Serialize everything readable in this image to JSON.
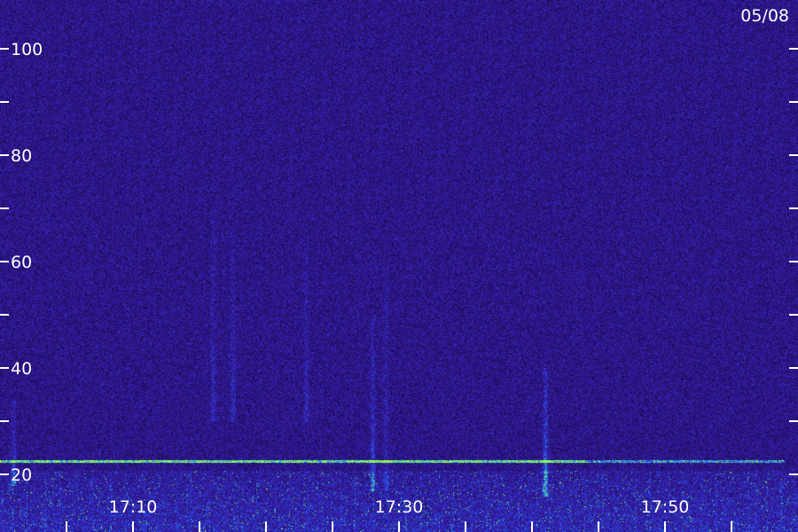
{
  "date_label": "05/08",
  "chart_data": {
    "type": "heatmap",
    "title": "",
    "xlabel": "",
    "ylabel": "",
    "ylim": [
      16,
      110
    ],
    "y_ticks_labeled": [
      20,
      40,
      60,
      80,
      100
    ],
    "y_ticks_minor": [
      30,
      50,
      70,
      90
    ],
    "x_time_range": [
      "17:00",
      "18:00"
    ],
    "x_ticks_labeled": [
      "17:10",
      "17:30",
      "17:50"
    ],
    "x_ticks_minor": [
      "17:05",
      "17:15",
      "17:20",
      "17:25",
      "17:35",
      "17:40",
      "17:45",
      "17:55"
    ],
    "colors": {
      "background": "#2a0f70",
      "noise_low": "#1a0a50",
      "noise_high": "#3a1fb0",
      "signal_mid": "#2060ff",
      "signal_high": "#30e0c0",
      "signal_peak": "#a0ff40"
    },
    "features": [
      {
        "kind": "horizontal_line",
        "freq": 22.5,
        "time_start": "17:00",
        "time_end": "17:44",
        "intensity": "high"
      },
      {
        "kind": "horizontal_line",
        "freq": 22.5,
        "time_start": "17:44",
        "time_end": "17:59",
        "intensity": "medium"
      },
      {
        "kind": "vertical_streak",
        "time": "17:16",
        "freq_low": 30,
        "freq_high": 70,
        "intensity": "low"
      },
      {
        "kind": "vertical_streak",
        "time": "17:17.5",
        "freq_low": 30,
        "freq_high": 66,
        "intensity": "low"
      },
      {
        "kind": "vertical_streak",
        "time": "17:23",
        "freq_low": 30,
        "freq_high": 64,
        "intensity": "low"
      },
      {
        "kind": "vertical_streak",
        "time": "17:28",
        "freq_low": 17,
        "freq_high": 50,
        "intensity": "medium"
      },
      {
        "kind": "vertical_streak",
        "time": "17:29",
        "freq_low": 17,
        "freq_high": 60,
        "intensity": "low"
      },
      {
        "kind": "vertical_streak",
        "time": "17:41",
        "freq_low": 16,
        "freq_high": 40,
        "intensity": "high"
      },
      {
        "kind": "vertical_streak",
        "time": "17:01",
        "freq_low": 18,
        "freq_high": 34,
        "intensity": "medium"
      }
    ]
  }
}
